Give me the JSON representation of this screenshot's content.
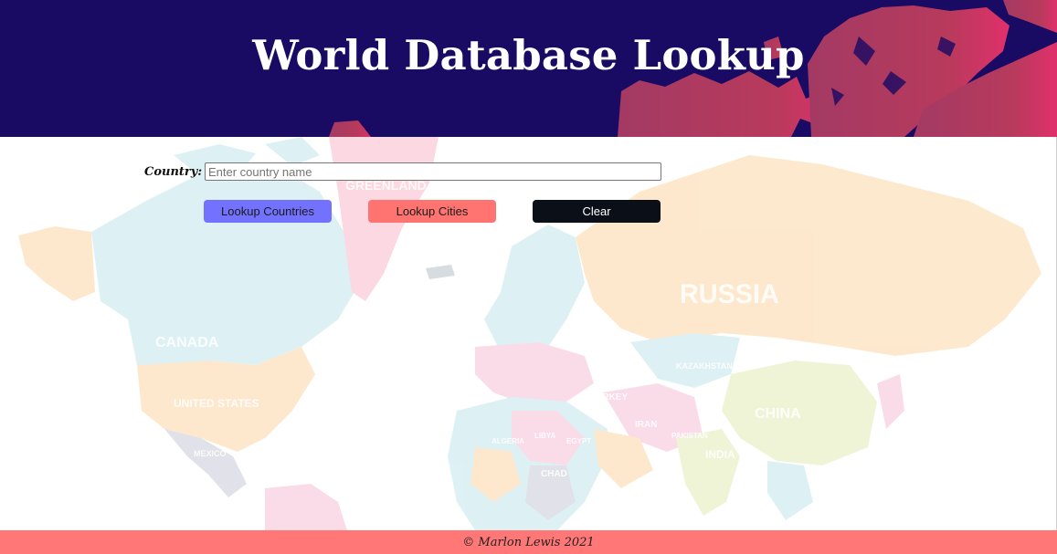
{
  "header": {
    "title": "World Database Lookup",
    "background_color": "#190a63",
    "art_icon": "world-map-silhouette"
  },
  "form": {
    "country_label": "Country:",
    "country_input": {
      "placeholder": "Enter country name",
      "value": ""
    },
    "buttons": {
      "lookup_countries": "Lookup Countries",
      "lookup_cities": "Lookup Cities",
      "clear": "Clear"
    }
  },
  "map": {
    "labels": {
      "greenland": "GREENLAND",
      "russia": "RUSSIA",
      "canada": "CANADA",
      "kazakhstan": "KAZAKHSTAN",
      "united_states": "UNITED STATES",
      "china": "CHINA",
      "iran": "IRAN",
      "india": "INDIA",
      "turkey": "TURKEY",
      "mexico": "MEXICO",
      "algeria": "ALGERIA",
      "libya": "LIBYA",
      "egypt": "EGYPT",
      "chad": "CHAD",
      "pakistan": "PAKISTAN"
    }
  },
  "footer": {
    "text": "© Marlon Lewis 2021"
  },
  "colors": {
    "accent_countries": "#7372ff",
    "accent_cities": "#ff7370",
    "clear_button": "#0a0f18",
    "footer": "#ff7777",
    "header_land": "#b03a5f"
  }
}
